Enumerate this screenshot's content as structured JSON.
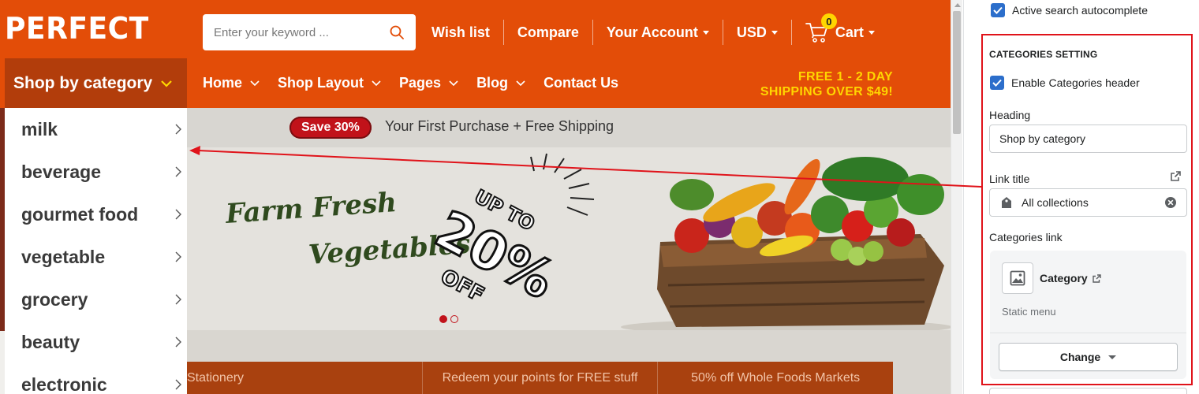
{
  "store": {
    "logo": "PERFECT",
    "search_placeholder": "Enter your keyword ...",
    "toplinks": [
      "Wish list",
      "Compare",
      "Your Account",
      "USD"
    ],
    "cart_label": "Cart",
    "cart_count": "0",
    "shop_by_category": "Shop by category",
    "nav": [
      "Home",
      "Shop Layout",
      "Pages",
      "Blog",
      "Contact Us"
    ],
    "promo_line1": "FREE 1 - 2 DAY",
    "promo_line2": "SHIPPING OVER $49!",
    "save_badge": "Save 30%",
    "save_text": "Your First Purchase + Free Shipping",
    "banner_title_1": "Farm Fresh",
    "banner_title_2": "Vegetables",
    "banner_sticker_1": "UP TO",
    "banner_sticker_2": "20%",
    "banner_sticker_3": "OFF",
    "categories": [
      "milk",
      "beverage",
      "gourmet food",
      "vegetable",
      "grocery",
      "beauty",
      "electronic"
    ],
    "offers": [
      "Stationery",
      "Redeem your points for FREE stuff",
      "50% off Whole Foods Markets"
    ],
    "colors": {
      "header": "#e34d08",
      "accent_yellow": "#ffd600",
      "save_red": "#c1121a"
    }
  },
  "panel": {
    "autocomplete_label": "Active search autocomplete",
    "section_title": "CATEGORIES SETTING",
    "enable_label": "Enable Categories header",
    "heading_label": "Heading",
    "heading_value": "Shop by category",
    "link_title_label": "Link title",
    "link_title_value": "All collections",
    "categories_link_label": "Categories link",
    "category_name": "Category",
    "static_menu": "Static menu",
    "change_button": "Change",
    "colors": {
      "checkbox": "#2c6ecb",
      "highlight_box": "#e0131a"
    }
  }
}
